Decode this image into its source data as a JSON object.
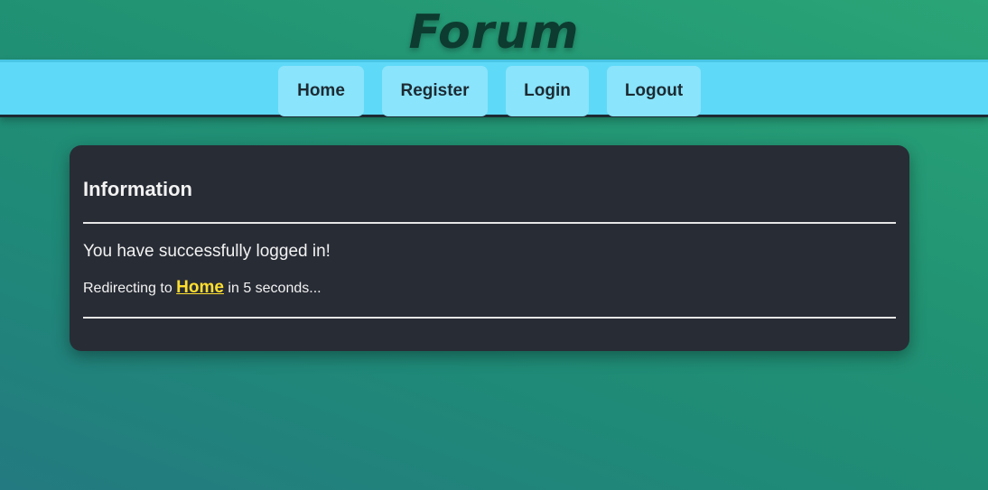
{
  "header": {
    "logo_text": "Forum"
  },
  "nav": {
    "items": [
      {
        "label": "Home"
      },
      {
        "label": "Register"
      },
      {
        "label": "Login"
      },
      {
        "label": "Logout"
      }
    ]
  },
  "info_card": {
    "title": "Information",
    "message": "You have successfully logged in!",
    "redirect_prefix": "Redirecting to ",
    "redirect_link": "Home",
    "redirect_suffix": " in 5 seconds..."
  },
  "colors": {
    "navbar": "#5fd9f8",
    "nav_button": "#8ae4fb",
    "card_background": "#282c35",
    "link": "#ffdf2f",
    "logo": "#0d3b2f"
  }
}
